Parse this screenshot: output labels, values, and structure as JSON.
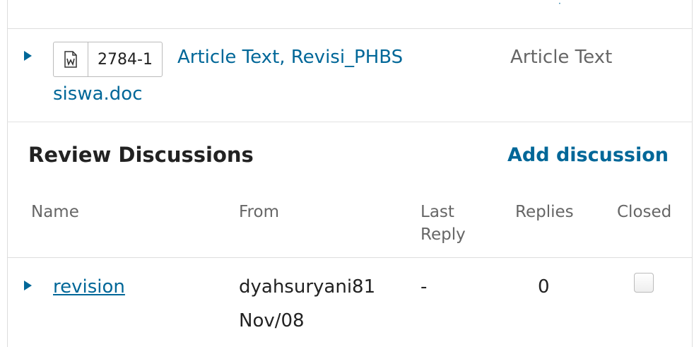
{
  "file": {
    "id": "2784-1",
    "name_line1": "Article Text, Revisi_PHBS",
    "name_line2": "siswa.doc",
    "type": "Article Text",
    "icon": "word-document-icon"
  },
  "review_discussions": {
    "title": "Review Discussions",
    "add_label": "Add discussion",
    "columns": {
      "name": "Name",
      "from": "From",
      "last_reply_line1": "Last",
      "last_reply_line2": "Reply",
      "replies": "Replies",
      "closed": "Closed"
    },
    "rows": [
      {
        "name": "revision",
        "from_user": "dyahsuryani81",
        "from_date": "Nov/08",
        "last_reply": "-",
        "replies": "0",
        "closed": false
      }
    ]
  },
  "colors": {
    "link": "#006798",
    "text": "#222222",
    "muted": "#666666",
    "border": "#dddddd"
  }
}
